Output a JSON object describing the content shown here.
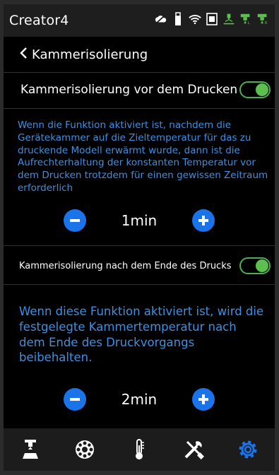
{
  "app": {
    "brand": "Creator4"
  },
  "header": {
    "title": "Kammerisolierung"
  },
  "section1": {
    "label": "Kammerisolierung vor dem Drucken",
    "toggle_on": true,
    "description": "Wenn die Funktion aktiviert ist, nachdem die Gerätekammer auf die Zieltemperatur für das zu druckende Modell erwärmt wurde, dann ist die Aufrechterhaltung der konstanten Temperatur vor dem Drucken trotzdem für einen gewissen Zeitraum erforderlich",
    "value": "1min"
  },
  "section2": {
    "label": "Kammerisolierung nach dem Ende des Drucks",
    "toggle_on": true,
    "description": "Wenn diese Funktion aktiviert ist, wird die festgelegte Kammertemperatur nach dem Ende des Druckvorgangs beibehalten.",
    "value": "2min"
  },
  "status_icons": [
    "cloud-icon",
    "usb-icon",
    "wifi-icon",
    "camera-icon",
    "print-head-icon",
    "extruder-temp-icon",
    "extruder-temp-icon"
  ],
  "nav_icons": [
    "print-icon",
    "filament-spool-icon",
    "thermometer-icon",
    "tools-icon",
    "settings-gear-icon"
  ],
  "colors": {
    "accent_blue": "#1a73e8",
    "desc_blue": "#3f8fe0",
    "toggle_green": "#5cbf4f"
  }
}
